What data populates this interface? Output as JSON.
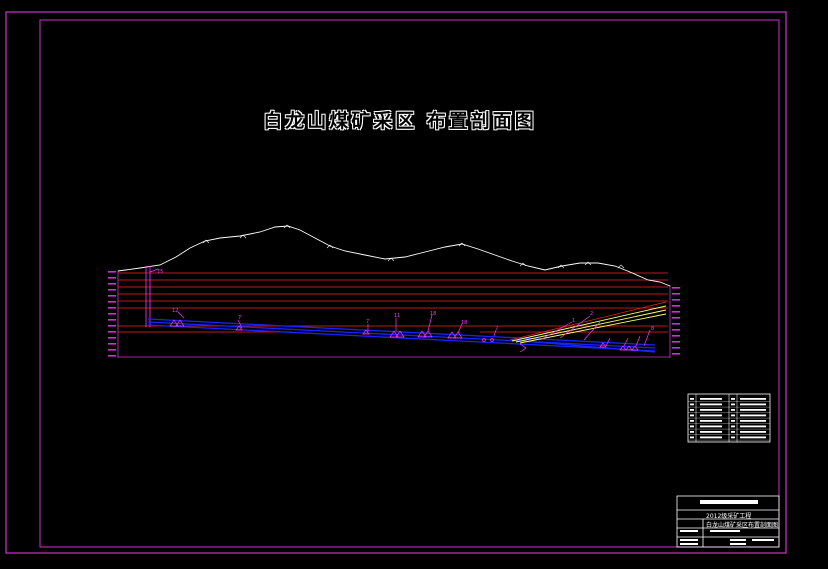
{
  "drawing": {
    "title": "白龙山煤矿采区 布置剖面图",
    "labels": {
      "shaft": "15",
      "l1": "12",
      "l2": "7",
      "l3": "7",
      "l4": "11",
      "l5": "18",
      "l6": "18",
      "l7": "7",
      "l8": "1",
      "l9": "2",
      "l10": "8"
    }
  },
  "title_block": {
    "project": "2012级采矿工程",
    "drawing_name": "白龙山煤矿采区布置剖面图"
  },
  "colors": {
    "frame": "#cc33cc",
    "ground": "#ffffff",
    "levels": "#ff2222",
    "seam": "#1a22ff",
    "incline": "#ffff66",
    "annotation": "#ff33ff"
  }
}
